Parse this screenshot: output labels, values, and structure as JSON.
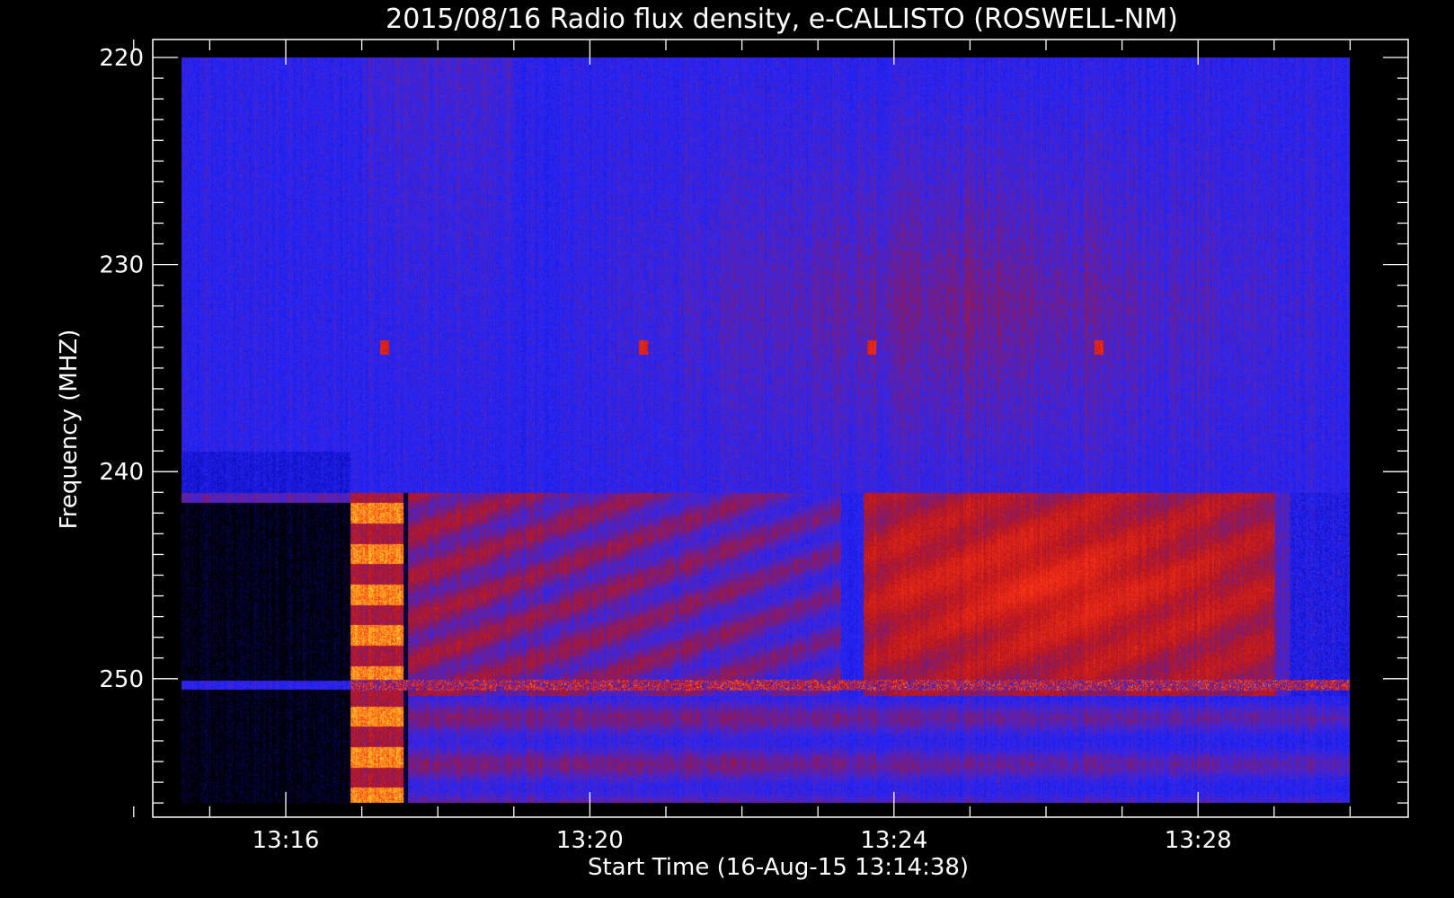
{
  "chart_data": {
    "type": "heatmap",
    "title": "2015/08/16  Radio flux density, e-CALLISTO (ROSWELL-NM)",
    "xlabel": "Start Time (16-Aug-15 13:14:38)",
    "ylabel": "Frequency (MHZ)",
    "x_start": "13:14:38",
    "xlim_minutes": [
      13.83,
      30.33
    ],
    "ylim": [
      220,
      256
    ],
    "y_inverted": true,
    "data_extent": {
      "t_start_minutes": 14.63,
      "t_end_minutes": 30.0,
      "f_top": 220,
      "f_bottom": 256
    },
    "xticks": [
      {
        "minutes": 16,
        "label": "13:16"
      },
      {
        "minutes": 20,
        "label": "13:20"
      },
      {
        "minutes": 24,
        "label": "13:24"
      },
      {
        "minutes": 28,
        "label": "13:28"
      }
    ],
    "yticks": [
      {
        "value": 220,
        "label": "220"
      },
      {
        "value": 230,
        "label": "230"
      },
      {
        "value": 240,
        "label": "240"
      },
      {
        "value": 250,
        "label": "250"
      }
    ],
    "colormap": [
      "#000000",
      "#0a0ab4",
      "#2828ff",
      "#b4141e",
      "#ff3214",
      "#ffc828"
    ],
    "features": [
      {
        "name": "data-gap",
        "t_start": 14.63,
        "t_end": 16.85,
        "f_start": 241.5,
        "f_end": 256
      },
      {
        "name": "strong-burst",
        "t_start": 16.85,
        "t_end": 17.6,
        "f_start": 241,
        "f_end": 256
      },
      {
        "name": "enhanced-emission",
        "t_start": 23.5,
        "t_end": 29.0,
        "f_start": 241,
        "f_end": 250
      },
      {
        "name": "interference-line",
        "frequency": 250.3
      }
    ]
  }
}
